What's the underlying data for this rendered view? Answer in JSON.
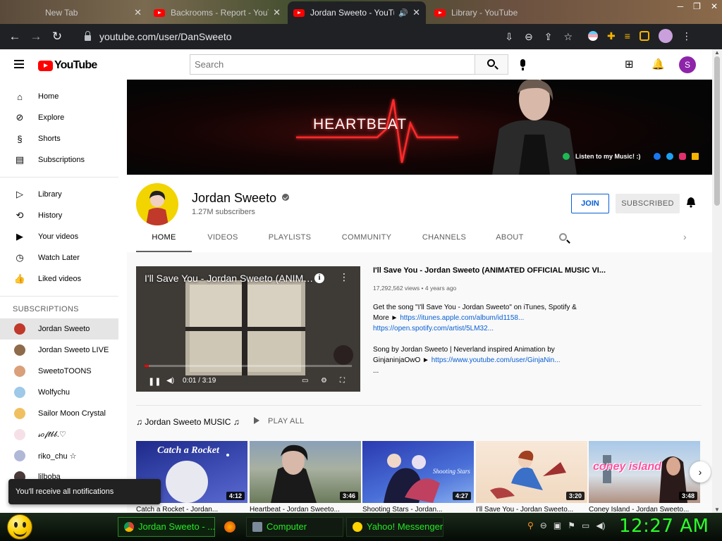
{
  "browser": {
    "tabs": [
      {
        "title": "New Tab",
        "active": false
      },
      {
        "title": "Backrooms - Report - YouTube",
        "active": false
      },
      {
        "title": "Jordan Sweeto - YouTube",
        "active": true
      },
      {
        "title": "Library - YouTube",
        "active": false
      }
    ],
    "url": "youtube.com/user/DanSweeto"
  },
  "masthead": {
    "logo_text": "YouTube",
    "search_placeholder": "Search",
    "avatar_letter": "S"
  },
  "guide": {
    "main": [
      {
        "label": "Home",
        "icon": "home-icon"
      },
      {
        "label": "Explore",
        "icon": "compass-icon"
      },
      {
        "label": "Shorts",
        "icon": "shorts-icon"
      },
      {
        "label": "Subscriptions",
        "icon": "subscriptions-icon"
      }
    ],
    "library": [
      {
        "label": "Library",
        "icon": "library-icon"
      },
      {
        "label": "History",
        "icon": "history-icon"
      },
      {
        "label": "Your videos",
        "icon": "your-videos-icon"
      },
      {
        "label": "Watch Later",
        "icon": "clock-icon"
      },
      {
        "label": "Liked videos",
        "icon": "thumbs-up-icon"
      }
    ],
    "subscriptions_heading": "SUBSCRIPTIONS",
    "subscriptions": [
      {
        "label": "Jordan Sweeto",
        "color": "#c0392b"
      },
      {
        "label": "Jordan Sweeto LIVE",
        "color": "#8e6b4a"
      },
      {
        "label": "SweetoTOONS",
        "color": "#d9a07a"
      },
      {
        "label": "Wolfychu",
        "color": "#9ec9e8"
      },
      {
        "label": "Sailor Moon Crystal",
        "color": "#f0c060"
      },
      {
        "label": "𝓈𝑜𝒻𝓉𝒷𝒷.♡",
        "color": "#f6e0e8"
      },
      {
        "label": "riko_chu ☆",
        "color": "#b0b8d8"
      },
      {
        "label": "lilboba",
        "color": "#4a3a3a"
      }
    ]
  },
  "banner": {
    "heartbeat_text": "HEARTBEAT",
    "listen_text": "Listen to my Music! :)"
  },
  "channel": {
    "name": "Jordan Sweeto",
    "subscribers": "1.27M subscribers",
    "join_label": "JOIN",
    "subscribed_label": "SUBSCRIBED",
    "tabs": [
      "HOME",
      "VIDEOS",
      "PLAYLISTS",
      "COMMUNITY",
      "CHANNELS",
      "ABOUT"
    ],
    "active_tab": "HOME"
  },
  "featured": {
    "player_title": "I'll Save You - Jordan Sweeto (ANIMATED OFFICIAL MUSIC VIDEO)",
    "time": "0:01 / 3:19",
    "progress": 0.005,
    "title": "I'll Save You - Jordan Sweeto (ANIMATED OFFICIAL MUSIC VI...",
    "meta": "17,292,562 views • 4 years ago",
    "desc_1": "Get the song \"I'll Save You - Jordan Sweeto\" on iTunes, Spotify & More ► ",
    "link_1": "https://itunes.apple.com/album/id1158...",
    "link_2": "https://open.spotify.com/artist/5LM32...",
    "desc_2": "Song by Jordan Sweeto | Neverland inspired Animation by GinjaninjaOwO ► ",
    "link_3": "https://www.youtube.com/user/GinjaNin...",
    "desc_ellipsis": "..."
  },
  "shelf": {
    "title": "♫ Jordan Sweeto MUSIC ♫",
    "play_all": "PLAY ALL",
    "videos": [
      {
        "caption": "Catch a Rocket - Jordan...",
        "duration": "4:12",
        "thumb_text": "Catch a Rocket"
      },
      {
        "caption": "Heartbeat - Jordan Sweeto...",
        "duration": "3:46",
        "thumb_text": ""
      },
      {
        "caption": "Shooting Stars - Jordan...",
        "duration": "4:27",
        "thumb_text": "Shooting Stars"
      },
      {
        "caption": "I'll Save You - Jordan Sweeto...",
        "duration": "3:20",
        "thumb_text": ""
      },
      {
        "caption": "Coney Island - Jordan Sweeto...",
        "duration": "3:48",
        "thumb_text": "coney island"
      }
    ]
  },
  "toast": "You'll receive all notifications",
  "taskbar": {
    "buttons": [
      {
        "label": "Jordan Sweeto - ...",
        "active": true
      },
      {
        "label": "Computer",
        "active": false
      },
      {
        "label": "Yahoo! Messenger",
        "active": false
      }
    ],
    "clock": "12:27 AM"
  }
}
